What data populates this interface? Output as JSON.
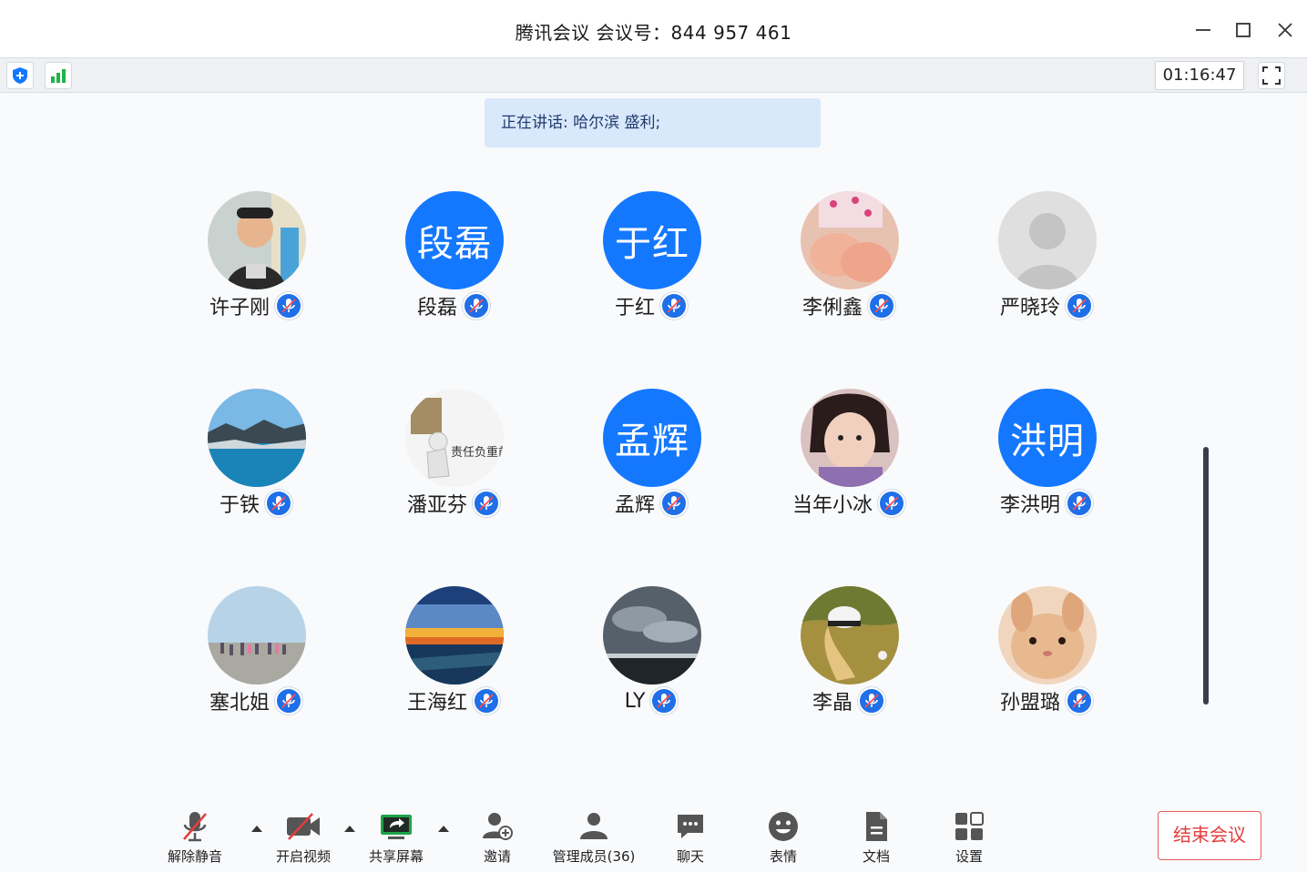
{
  "window": {
    "title": "腾讯会议 会议号：844 957 461"
  },
  "statusbar": {
    "timer": "01:16:47"
  },
  "speaking": {
    "text": "正在讲话: 哈尔滨 盛利;"
  },
  "participants": [
    {
      "name": "许子刚",
      "avatar_text": "",
      "avatar_kind": "photo-man"
    },
    {
      "name": "段磊",
      "avatar_text": "段磊",
      "avatar_kind": "text"
    },
    {
      "name": "于红",
      "avatar_text": "于红",
      "avatar_kind": "text"
    },
    {
      "name": "李俐鑫",
      "avatar_text": "",
      "avatar_kind": "photo-baby"
    },
    {
      "name": "严晓玲",
      "avatar_text": "",
      "avatar_kind": "placeholder"
    },
    {
      "name": "于铁",
      "avatar_text": "",
      "avatar_kind": "photo-lake"
    },
    {
      "name": "潘亚芬",
      "avatar_text": "",
      "avatar_kind": "photo-responsibility",
      "avatar_caption": "责任负重前"
    },
    {
      "name": "孟辉",
      "avatar_text": "孟辉",
      "avatar_kind": "text"
    },
    {
      "name": "当年小冰",
      "avatar_text": "",
      "avatar_kind": "photo-woman"
    },
    {
      "name": "李洪明",
      "avatar_text": "洪明",
      "avatar_kind": "text"
    },
    {
      "name": "塞北姐",
      "avatar_text": "",
      "avatar_kind": "photo-beach"
    },
    {
      "name": "王海红",
      "avatar_text": "",
      "avatar_kind": "photo-sunset"
    },
    {
      "name": "LY",
      "avatar_text": "",
      "avatar_kind": "photo-clouds"
    },
    {
      "name": "李晶",
      "avatar_text": "",
      "avatar_kind": "photo-field"
    },
    {
      "name": "孙盟璐",
      "avatar_text": "",
      "avatar_kind": "photo-rabbit"
    }
  ],
  "toolbar": {
    "unmute": "解除静音",
    "start_video": "开启视频",
    "share_screen": "共享屏幕",
    "invite": "邀请",
    "manage_members": "管理成员(36)",
    "chat": "聊天",
    "reactions": "表情",
    "documents": "文档",
    "settings": "设置",
    "end_meeting": "结束会议"
  },
  "colors": {
    "accent": "#1478ff",
    "end_red": "#e43d3d",
    "share_green": "#1fa34a"
  }
}
